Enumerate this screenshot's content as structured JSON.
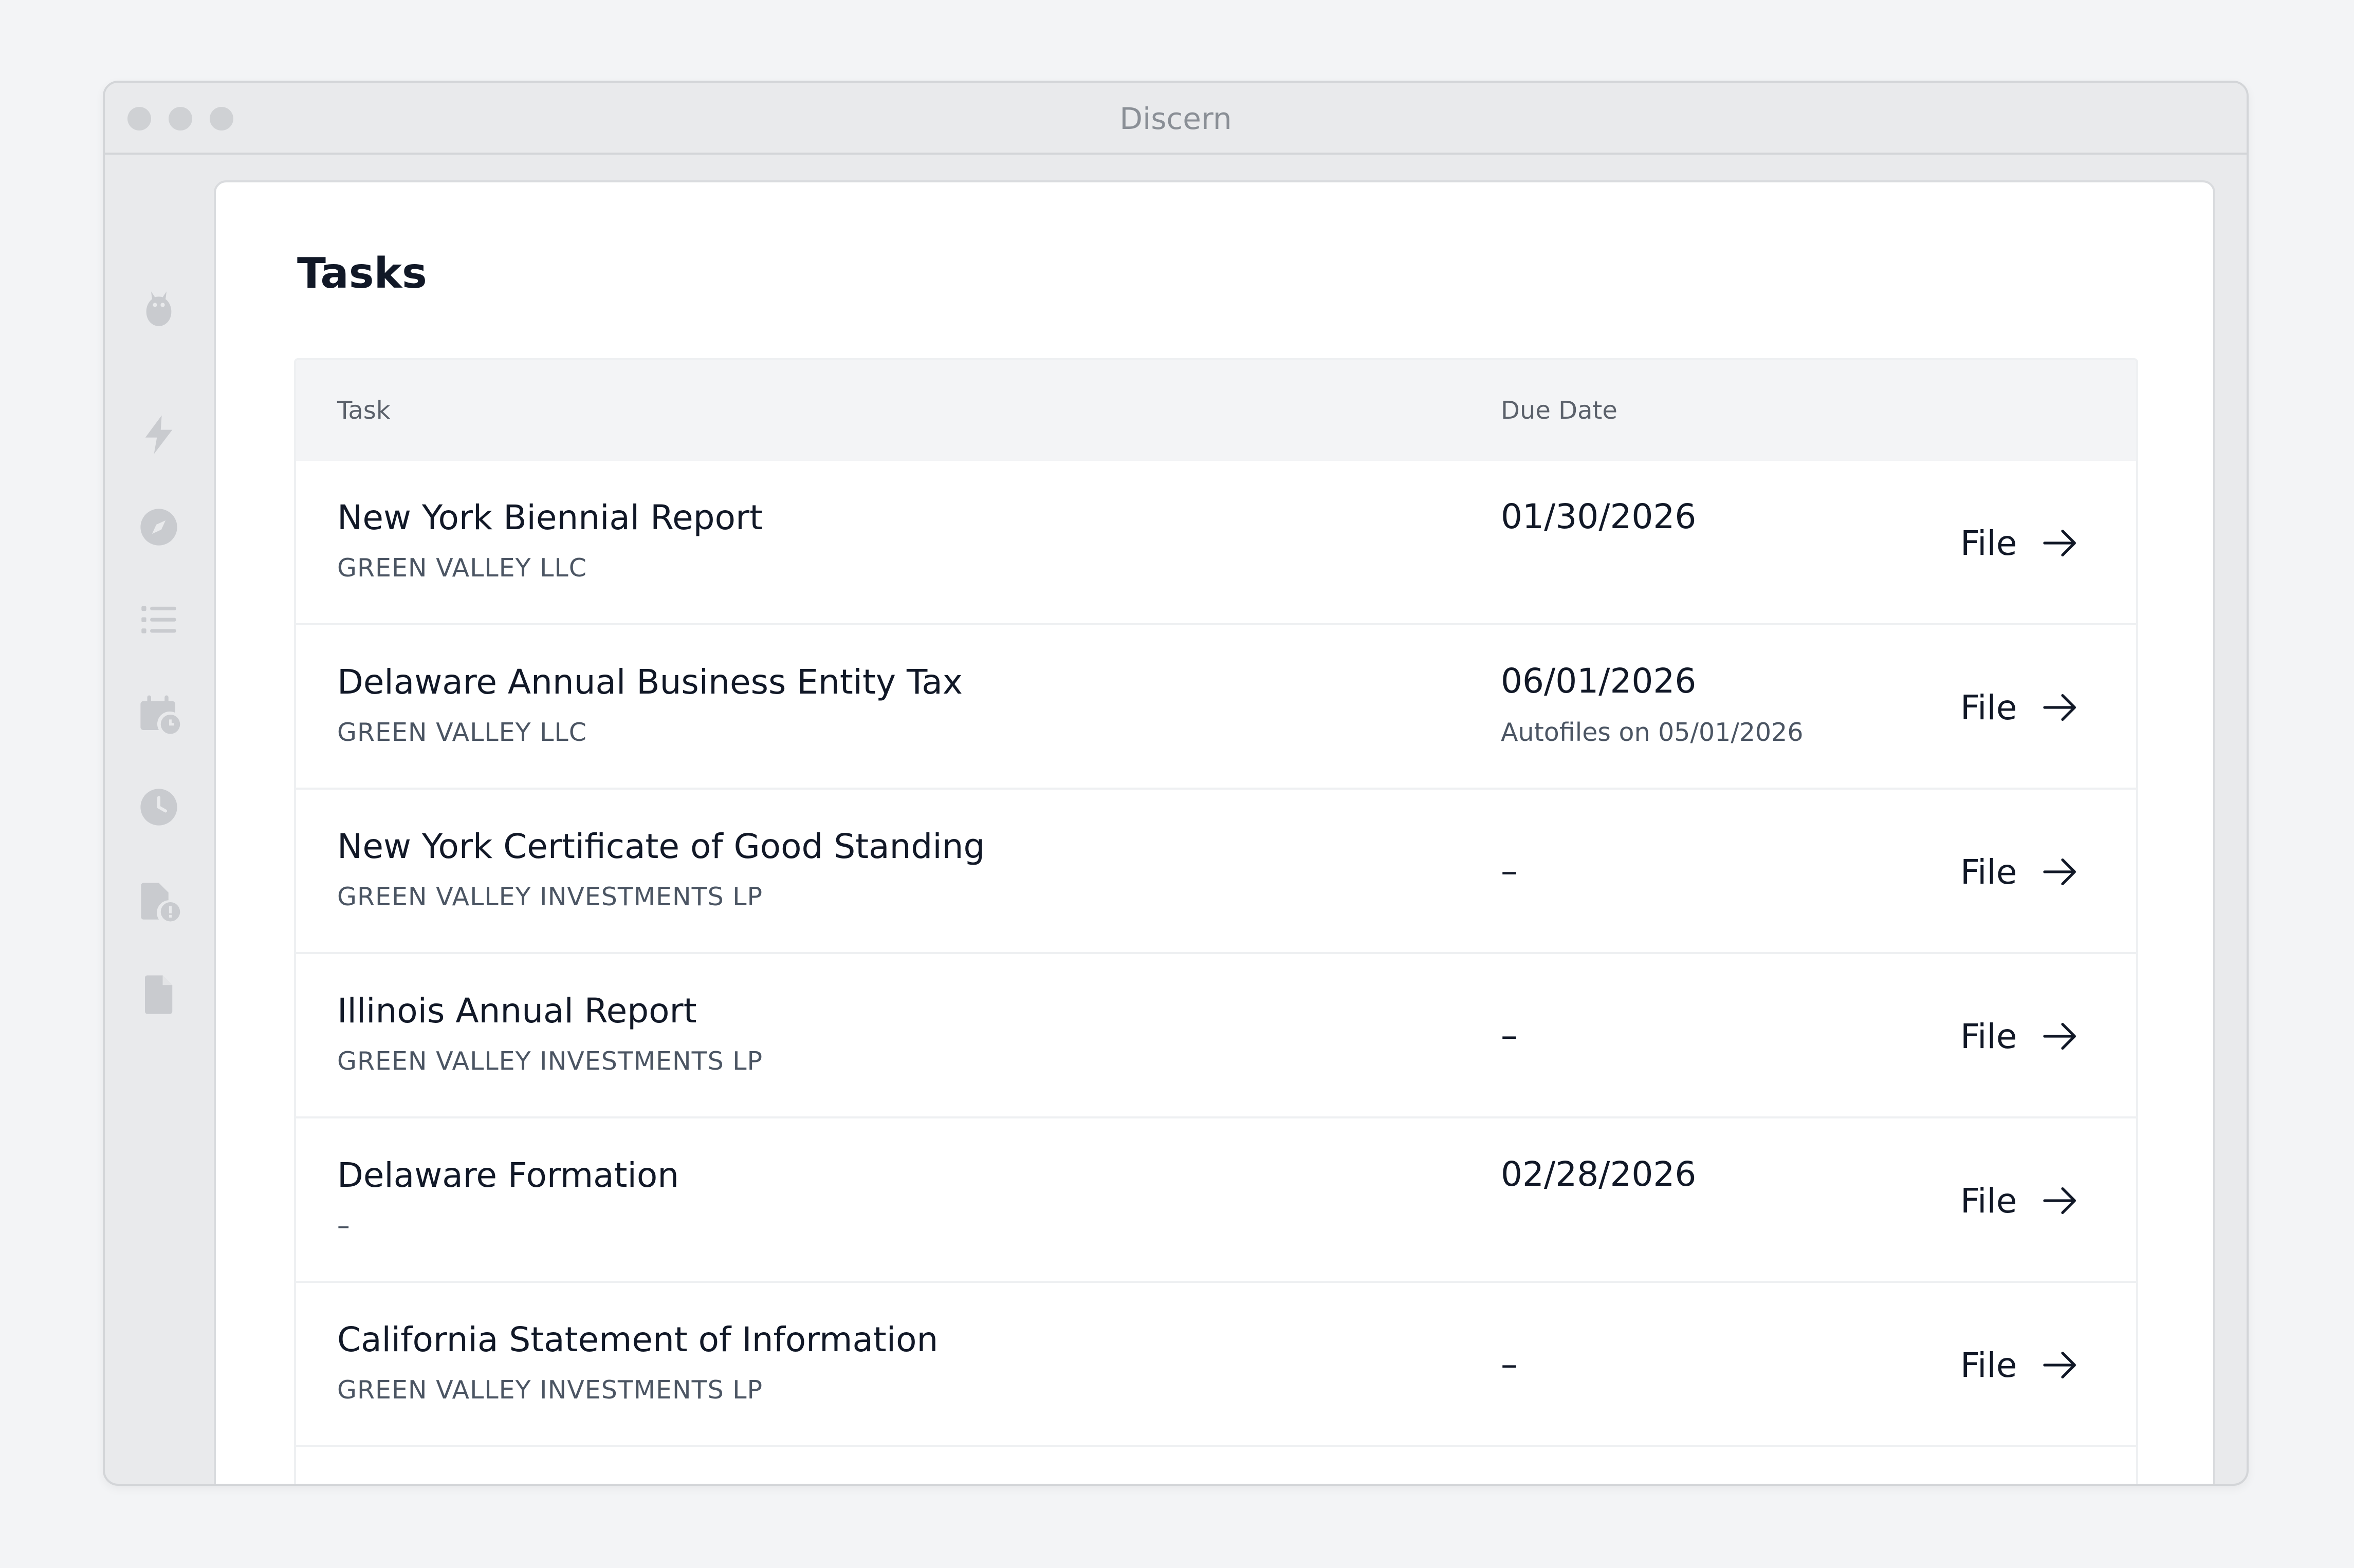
{
  "window": {
    "title": "Discern"
  },
  "sidebar": {
    "items": [
      {
        "icon": "owl-logo-icon"
      },
      {
        "icon": "lightning-icon"
      },
      {
        "icon": "compass-icon"
      },
      {
        "icon": "list-icon"
      },
      {
        "icon": "calendar-clock-icon"
      },
      {
        "icon": "clock-icon"
      },
      {
        "icon": "document-alert-icon"
      },
      {
        "icon": "document-icon"
      }
    ]
  },
  "main": {
    "title": "Tasks",
    "table": {
      "columns": {
        "task": "Task",
        "due_date": "Due Date"
      },
      "rows": [
        {
          "title": "New York Biennial Report",
          "entity": "GREEN VALLEY LLC",
          "due": "01/30/2026",
          "due_note": "",
          "action": "File"
        },
        {
          "title": "Delaware Annual Business Entity Tax",
          "entity": "GREEN VALLEY LLC",
          "due": "06/01/2026",
          "due_note": "Autofiles on 05/01/2026",
          "action": "File"
        },
        {
          "title": "New York Certificate of Good Standing",
          "entity": "GREEN VALLEY INVESTMENTS LP",
          "due": "–",
          "due_note": "",
          "action": "File"
        },
        {
          "title": "Illinois Annual Report",
          "entity": "GREEN VALLEY INVESTMENTS LP",
          "due": "–",
          "due_note": "",
          "action": "File"
        },
        {
          "title": "Delaware Formation",
          "entity": "–",
          "due": "02/28/2026",
          "due_note": "",
          "action": "File"
        },
        {
          "title": "California Statement of Information",
          "entity": "GREEN VALLEY INVESTMENTS LP",
          "due": "–",
          "due_note": "",
          "action": "File"
        }
      ]
    }
  },
  "colors": {
    "background": "#f3f4f6",
    "window_chrome": "#e9eaec",
    "sidebar_icon": "#c9cbcf",
    "text_primary": "#111827",
    "text_secondary": "#4b5563"
  }
}
